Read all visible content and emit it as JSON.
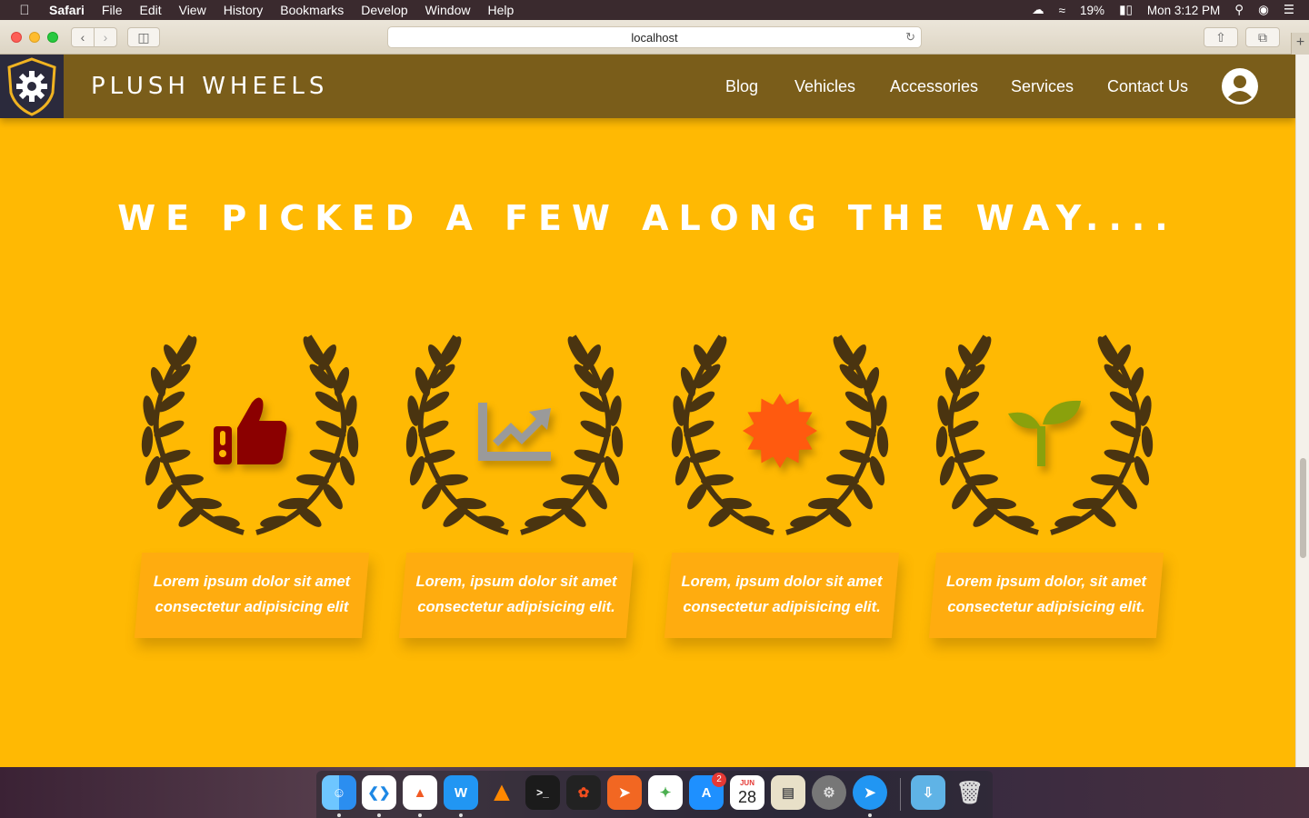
{
  "menubar": {
    "app_name": "Safari",
    "items": [
      "File",
      "Edit",
      "View",
      "History",
      "Bookmarks",
      "Develop",
      "Window",
      "Help"
    ],
    "battery": "19%",
    "clock": "Mon 3:12 PM"
  },
  "browser": {
    "url": "localhost"
  },
  "site": {
    "brand": "PLUSH WHEELS",
    "nav": {
      "blog": "Blog",
      "vehicles": "Vehicles",
      "accessories": "Accessories",
      "services": "Services",
      "contact": "Contact Us"
    },
    "heading": "WE PICKED A FEW ALONG THE WAY....",
    "awards": [
      {
        "icon": "thumbs-up-icon",
        "color": "#8b0000",
        "line1": "Lorem ipsum dolor sit amet",
        "line2": "consectetur adipisicing elit"
      },
      {
        "icon": "chart-trend-icon",
        "color": "#999999",
        "line1": "Lorem, ipsum dolor sit amet",
        "line2": "consectetur adipisicing elit."
      },
      {
        "icon": "badge-seal-icon",
        "color": "#ff5a0f",
        "line1": "Lorem, ipsum dolor sit amet",
        "line2": "consectetur adipisicing elit."
      },
      {
        "icon": "sprout-icon",
        "color": "#8aa10c",
        "line1": "Lorem ipsum dolor, sit amet",
        "line2": "consectetur adipisicing elit."
      }
    ]
  },
  "dock": {
    "badge": "2",
    "calendar_month": "JUN",
    "calendar_day": "28"
  },
  "colors": {
    "page_bg": "#ffb903",
    "nav_bg": "#7a5d1a",
    "card_bg": "#ffac0f",
    "wreath": "#4a3410"
  }
}
